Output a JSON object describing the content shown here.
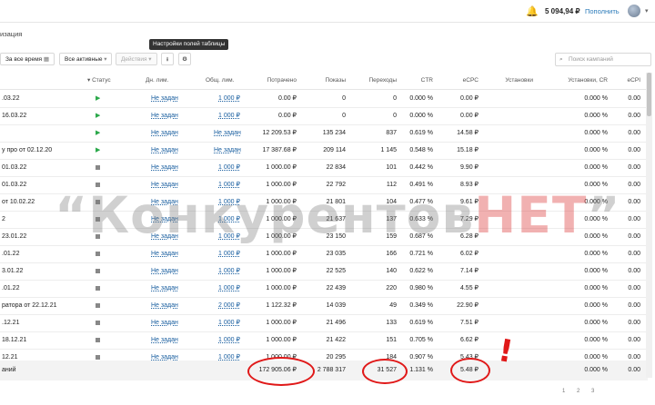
{
  "topbar": {
    "balance": "5 094,94 ₽",
    "topup": "Пополнить"
  },
  "breadcrumb": "изация",
  "toolbar": {
    "period": "За все время",
    "filter": "Все активные",
    "actions": "Действия",
    "tooltip": "Настройки полей таблицы",
    "search_placeholder": "Поиск кампаний"
  },
  "columns": {
    "status": "Статус",
    "day_limit": "Дн. лим.",
    "total_limit": "Общ. лим.",
    "spent": "Потрачено",
    "impressions": "Показы",
    "clicks": "Переходы",
    "ctr": "CTR",
    "ecpc": "eCPC",
    "installs": "Установки",
    "install_cr": "Установки, CR",
    "ecpi": "eCPI"
  },
  "rows": [
    {
      "name": ".03.22",
      "status": "active",
      "day": "Не задан",
      "total": "1 000 ₽",
      "spent": "0.00 ₽",
      "imp": "0",
      "clk": "0",
      "ctr": "0.000 %",
      "ecpc": "0.00 ₽",
      "cr": "0.000 %",
      "ecpi": "0.00"
    },
    {
      "name": "16.03.22",
      "status": "active",
      "day": "Не задан",
      "total": "1 000 ₽",
      "spent": "0.00 ₽",
      "imp": "0",
      "clk": "0",
      "ctr": "0.000 %",
      "ecpc": "0.00 ₽",
      "cr": "0.000 %",
      "ecpi": "0.00"
    },
    {
      "name": "",
      "status": "active",
      "day": "Не задан",
      "total": "Не задан",
      "spent": "12 209.53 ₽",
      "imp": "135 234",
      "clk": "837",
      "ctr": "0.619 %",
      "ecpc": "14.58 ₽",
      "cr": "0.000 %",
      "ecpi": "0.00"
    },
    {
      "name": "у про от 02.12.20",
      "status": "active",
      "day": "Не задан",
      "total": "Не задан",
      "spent": "17 387.68 ₽",
      "imp": "209 114",
      "clk": "1 145",
      "ctr": "0.548 %",
      "ecpc": "15.18 ₽",
      "cr": "0.000 %",
      "ecpi": "0.00"
    },
    {
      "name": "01.03.22",
      "status": "stopped",
      "day": "Не задан",
      "total": "1 000 ₽",
      "spent": "1 000.00 ₽",
      "imp": "22 834",
      "clk": "101",
      "ctr": "0.442 %",
      "ecpc": "9.90 ₽",
      "cr": "0.000 %",
      "ecpi": "0.00"
    },
    {
      "name": "01.03.22",
      "status": "stopped",
      "day": "Не задан",
      "total": "1 000 ₽",
      "spent": "1 000.00 ₽",
      "imp": "22 792",
      "clk": "112",
      "ctr": "0.491 %",
      "ecpc": "8.93 ₽",
      "cr": "0.000 %",
      "ecpi": "0.00"
    },
    {
      "name": "от 10.02.22",
      "status": "stopped",
      "day": "Не задан",
      "total": "1 000 ₽",
      "spent": "1 000.00 ₽",
      "imp": "21 801",
      "clk": "104",
      "ctr": "0.477 %",
      "ecpc": "9.61 ₽",
      "cr": "0.000 %",
      "ecpi": "0.00"
    },
    {
      "name": "2",
      "status": "stopped",
      "day": "Не задан",
      "total": "1 000 ₽",
      "spent": "1 000.00 ₽",
      "imp": "21 637",
      "clk": "137",
      "ctr": "0.633 %",
      "ecpc": "7.29 ₽",
      "cr": "0.000 %",
      "ecpi": "0.00"
    },
    {
      "name": "23.01.22",
      "status": "stopped",
      "day": "Не задан",
      "total": "1 000 ₽",
      "spent": "1 000.00 ₽",
      "imp": "23 150",
      "clk": "159",
      "ctr": "0.687 %",
      "ecpc": "6.28 ₽",
      "cr": "0.000 %",
      "ecpi": "0.00"
    },
    {
      "name": ".01.22",
      "status": "stopped",
      "day": "Не задан",
      "total": "1 000 ₽",
      "spent": "1 000.00 ₽",
      "imp": "23 035",
      "clk": "166",
      "ctr": "0.721 %",
      "ecpc": "6.02 ₽",
      "cr": "0.000 %",
      "ecpi": "0.00"
    },
    {
      "name": "3.01.22",
      "status": "stopped",
      "day": "Не задан",
      "total": "1 000 ₽",
      "spent": "1 000.00 ₽",
      "imp": "22 525",
      "clk": "140",
      "ctr": "0.622 %",
      "ecpc": "7.14 ₽",
      "cr": "0.000 %",
      "ecpi": "0.00"
    },
    {
      "name": ".01.22",
      "status": "stopped",
      "day": "Не задан",
      "total": "1 000 ₽",
      "spent": "1 000.00 ₽",
      "imp": "22 439",
      "clk": "220",
      "ctr": "0.980 %",
      "ecpc": "4.55 ₽",
      "cr": "0.000 %",
      "ecpi": "0.00"
    },
    {
      "name": "ратора от 22.12.21",
      "status": "stopped",
      "day": "Не задан",
      "total": "2 000 ₽",
      "spent": "1 122.32 ₽",
      "imp": "14 039",
      "clk": "49",
      "ctr": "0.349 %",
      "ecpc": "22.90 ₽",
      "cr": "0.000 %",
      "ecpi": "0.00"
    },
    {
      "name": ".12.21",
      "status": "stopped",
      "day": "Не задан",
      "total": "1 000 ₽",
      "spent": "1 000.00 ₽",
      "imp": "21 496",
      "clk": "133",
      "ctr": "0.619 %",
      "ecpc": "7.51 ₽",
      "cr": "0.000 %",
      "ecpi": "0.00"
    },
    {
      "name": "18.12.21",
      "status": "stopped",
      "day": "Не задан",
      "total": "1 000 ₽",
      "spent": "1 000.00 ₽",
      "imp": "21 422",
      "clk": "151",
      "ctr": "0.705 %",
      "ecpc": "6.62 ₽",
      "cr": "0.000 %",
      "ecpi": "0.00"
    },
    {
      "name": "12.21",
      "status": "stopped",
      "day": "Не задан",
      "total": "1 000 ₽",
      "spent": "1 000.00 ₽",
      "imp": "20 295",
      "clk": "184",
      "ctr": "0.907 %",
      "ecpc": "5.43 ₽",
      "cr": "0.000 %",
      "ecpi": "0.00"
    }
  ],
  "totals": {
    "label": "аний",
    "spent": "172 905.06 ₽",
    "imp": "2 788 317",
    "clk": "31 527",
    "ctr": "1.131 %",
    "ecpc": "5.48 ₽",
    "cr": "0.000 %",
    "ecpi": "0.00"
  },
  "watermark": {
    "main": "“Конкуренто",
    "mid": "в",
    "red": "НЕТ",
    "end": "”"
  },
  "annotation": "!",
  "pagination": [
    "1",
    "2",
    "3"
  ],
  "colors": {
    "accent": "#2a7ab9",
    "active": "#2aa84a",
    "highlight": "#e01818"
  }
}
